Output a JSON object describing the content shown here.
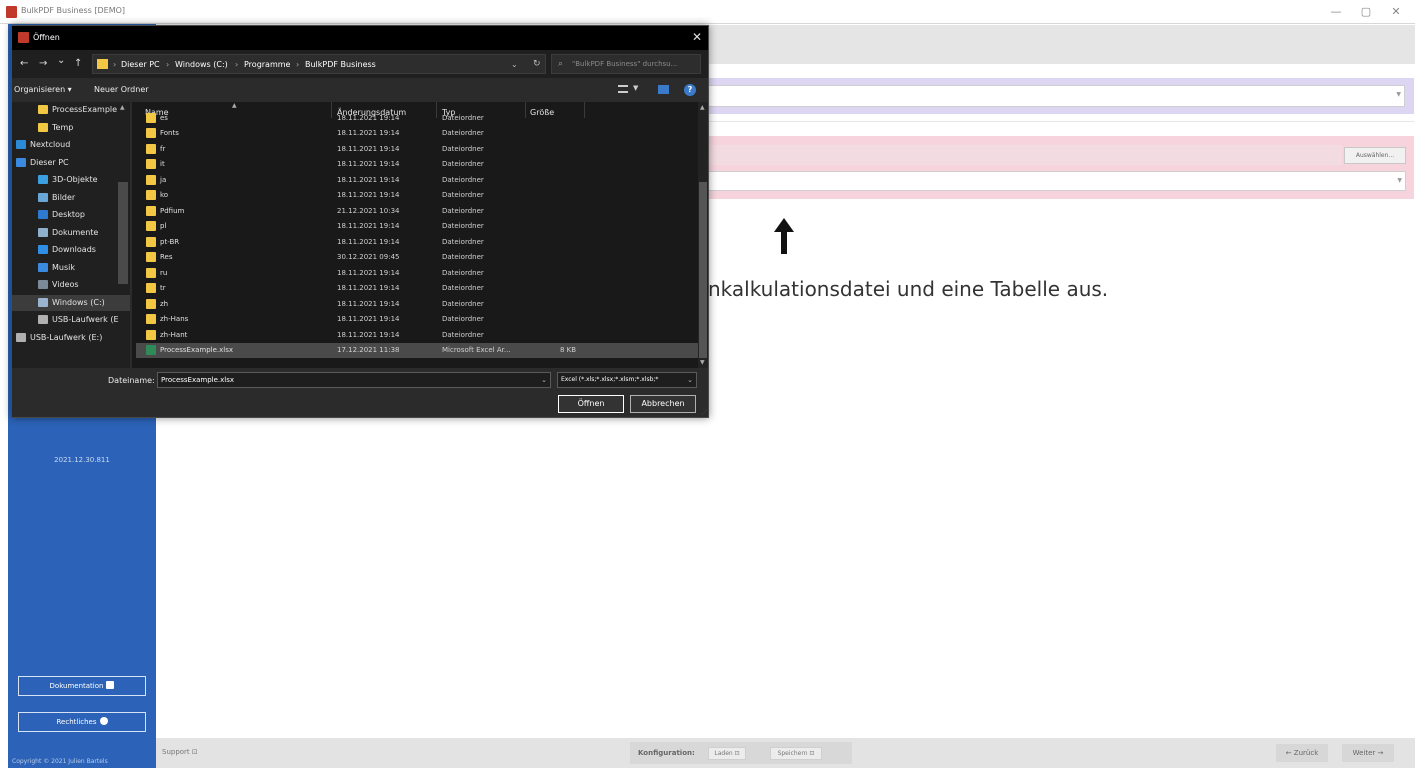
{
  "app": {
    "title": "BulkPDF Business [DEMO]",
    "window_controls": {
      "minimize": "—",
      "maximize": "▢",
      "close": "✕"
    }
  },
  "sidebar": {
    "version": "2021.12.30.811",
    "documentation_label": "Dokumentation",
    "legal_label": "Rechtliches",
    "copyright": "Copyright © 2021 Julien Bartels"
  },
  "main": {
    "choose_button": "Auswählen...",
    "hint_text": "nkalkulationsdatei und eine Tabelle aus.",
    "arrow": "↑"
  },
  "bottom_bar": {
    "support_label": "Support ⊡",
    "konfiguration_label": "Konfiguration:",
    "load_label": "Laden ⊡",
    "save_label": "Speichern ⊡",
    "back_label": "← Zurück",
    "next_label": "Weiter →"
  },
  "dialog": {
    "title": "Öffnen",
    "close": "✕",
    "nav": {
      "back": "←",
      "forward": "→",
      "recent": "⌄",
      "up": "↑"
    },
    "breadcrumbs": [
      "Dieser PC",
      "Windows (C:)",
      "Programme",
      "BulkPDF Business"
    ],
    "breadcrumb_separator": "›",
    "address_chevron": "⌄",
    "refresh": "↻",
    "search_placeholder": "\"BulkPDF Business\" durchsu...",
    "toolbar": {
      "organize": "Organisieren ▾",
      "new_folder": "Neuer Ordner",
      "help": "?"
    },
    "navigation_pane": [
      {
        "label": "ProcessExample",
        "icon": "folder-icon",
        "color": "#f2c744",
        "indent": 1
      },
      {
        "label": "Temp",
        "icon": "folder-icon",
        "color": "#f2c744",
        "indent": 1
      },
      {
        "label": "Nextcloud",
        "icon": "nextcloud-icon",
        "color": "#2c8bd6",
        "indent": 0
      },
      {
        "label": "Dieser PC",
        "icon": "computer-icon",
        "color": "#3a8be0",
        "indent": 0
      },
      {
        "label": "3D-Objekte",
        "icon": "cube-icon",
        "color": "#3aa0e0",
        "indent": 1
      },
      {
        "label": "Bilder",
        "icon": "pictures-icon",
        "color": "#6aa7d8",
        "indent": 1
      },
      {
        "label": "Desktop",
        "icon": "desktop-icon",
        "color": "#2f7ad1",
        "indent": 1
      },
      {
        "label": "Dokumente",
        "icon": "documents-icon",
        "color": "#8fb0cc",
        "indent": 1
      },
      {
        "label": "Downloads",
        "icon": "downloads-icon",
        "color": "#2f8fe6",
        "indent": 1
      },
      {
        "label": "Musik",
        "icon": "music-icon",
        "color": "#3a8be0",
        "indent": 1
      },
      {
        "label": "Videos",
        "icon": "videos-icon",
        "color": "#7a8a99",
        "indent": 1
      },
      {
        "label": "Windows (C:)",
        "icon": "drive-icon",
        "color": "#9ab4cf",
        "indent": 1,
        "selected": true
      },
      {
        "label": "USB-Laufwerk (E",
        "icon": "usb-drive-icon",
        "color": "#b0b0b0",
        "indent": 1
      },
      {
        "label": "USB-Laufwerk (E:)",
        "icon": "usb-drive-icon",
        "color": "#b0b0b0",
        "indent": 0
      }
    ],
    "columns": {
      "name": "Name",
      "date": "Änderungsdatum",
      "type": "Typ",
      "size": "Größe"
    },
    "files": [
      {
        "name": "es",
        "date": "18.11.2021 19:14",
        "type": "Dateiordner",
        "size": "",
        "kind": "folder",
        "partial": true
      },
      {
        "name": "Fonts",
        "date": "18.11.2021 19:14",
        "type": "Dateiordner",
        "size": "",
        "kind": "folder"
      },
      {
        "name": "fr",
        "date": "18.11.2021 19:14",
        "type": "Dateiordner",
        "size": "",
        "kind": "folder"
      },
      {
        "name": "it",
        "date": "18.11.2021 19:14",
        "type": "Dateiordner",
        "size": "",
        "kind": "folder"
      },
      {
        "name": "ja",
        "date": "18.11.2021 19:14",
        "type": "Dateiordner",
        "size": "",
        "kind": "folder"
      },
      {
        "name": "ko",
        "date": "18.11.2021 19:14",
        "type": "Dateiordner",
        "size": "",
        "kind": "folder"
      },
      {
        "name": "Pdfium",
        "date": "21.12.2021 10:34",
        "type": "Dateiordner",
        "size": "",
        "kind": "folder"
      },
      {
        "name": "pl",
        "date": "18.11.2021 19:14",
        "type": "Dateiordner",
        "size": "",
        "kind": "folder"
      },
      {
        "name": "pt-BR",
        "date": "18.11.2021 19:14",
        "type": "Dateiordner",
        "size": "",
        "kind": "folder"
      },
      {
        "name": "Res",
        "date": "30.12.2021 09:45",
        "type": "Dateiordner",
        "size": "",
        "kind": "folder"
      },
      {
        "name": "ru",
        "date": "18.11.2021 19:14",
        "type": "Dateiordner",
        "size": "",
        "kind": "folder"
      },
      {
        "name": "tr",
        "date": "18.11.2021 19:14",
        "type": "Dateiordner",
        "size": "",
        "kind": "folder"
      },
      {
        "name": "zh",
        "date": "18.11.2021 19:14",
        "type": "Dateiordner",
        "size": "",
        "kind": "folder"
      },
      {
        "name": "zh-Hans",
        "date": "18.11.2021 19:14",
        "type": "Dateiordner",
        "size": "",
        "kind": "folder"
      },
      {
        "name": "zh-Hant",
        "date": "18.11.2021 19:14",
        "type": "Dateiordner",
        "size": "",
        "kind": "folder"
      },
      {
        "name": "ProcessExample.xlsx",
        "date": "17.12.2021 11:38",
        "type": "Microsoft Excel Ar...",
        "size": "8 KB",
        "kind": "xlsx",
        "selected": true
      }
    ],
    "filename_label": "Dateiname:",
    "filename_value": "ProcessExample.xlsx",
    "filetype_value": "Excel (*.xls;*.xlsx;*.xlsm;*.xlsb;*",
    "open_button": "Öffnen",
    "cancel_button": "Abbrechen"
  }
}
